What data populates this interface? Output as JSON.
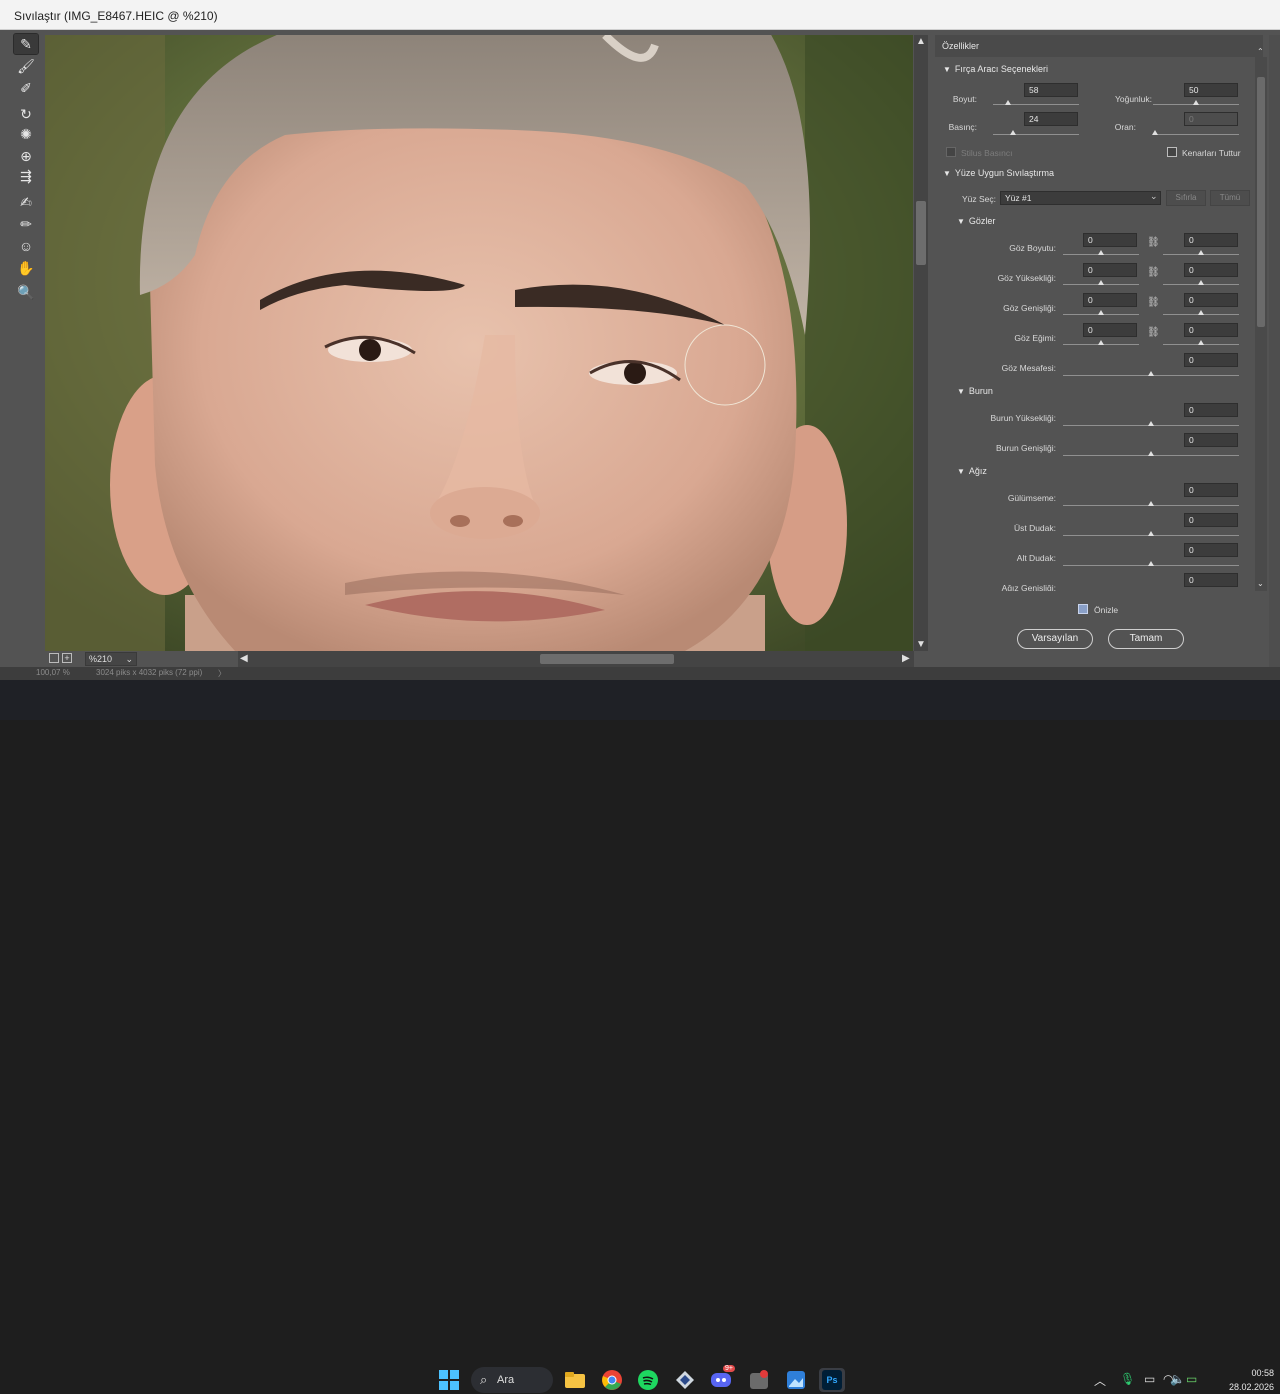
{
  "window": {
    "title": "Sıvılaştır (IMG_E8467.HEIC @ %210)"
  },
  "tools": [
    {
      "name": "forward-warp-icon",
      "glyph": "✎"
    },
    {
      "name": "reconstruct-icon",
      "glyph": "🖌"
    },
    {
      "name": "smooth-icon",
      "glyph": "✐"
    },
    {
      "name": "twirl-icon",
      "glyph": "↻"
    },
    {
      "name": "pucker-icon",
      "glyph": "✺"
    },
    {
      "name": "bloat-icon",
      "glyph": "⊕"
    },
    {
      "name": "push-left-icon",
      "glyph": "⇶"
    },
    {
      "name": "freeze-mask-icon",
      "glyph": "✍"
    },
    {
      "name": "thaw-mask-icon",
      "glyph": "✏"
    },
    {
      "name": "face-tool-icon",
      "glyph": "☺"
    },
    {
      "name": "hand-icon",
      "glyph": "✋"
    },
    {
      "name": "zoom-icon",
      "glyph": "🔍"
    }
  ],
  "canvas": {
    "zoom": "%210"
  },
  "statusbar": {
    "left": "100,07 %",
    "info": "3024 piks x 4032 piks (72 ppi)",
    "sep": "〉"
  },
  "panel": {
    "title": "Özellikler",
    "brush": {
      "title": "Fırça Aracı Seçenekleri",
      "size_label": "Boyut:",
      "size": "58",
      "density_label": "Yoğunluk:",
      "density": "50",
      "pressure_label": "Basınç:",
      "pressure": "24",
      "rate_label": "Oran:",
      "rate": "0",
      "stylus_label": "Stilus Basıncı",
      "pin_label": "Kenarları Tuttur"
    },
    "face": {
      "title": "Yüze Uygun Sıvılaştırma",
      "select_label": "Yüz Seç:",
      "select_value": "Yüz #1",
      "reset_label": "Sıfırla",
      "all_label": "Tümü",
      "eyes_title": "Gözler",
      "eyes": [
        {
          "label": "Göz Boyutu:",
          "left": "0",
          "right": "0"
        },
        {
          "label": "Göz Yüksekliği:",
          "left": "0",
          "right": "0"
        },
        {
          "label": "Göz Genişliği:",
          "left": "0",
          "right": "0"
        },
        {
          "label": "Göz Eğimi:",
          "left": "0",
          "right": "0"
        }
      ],
      "eye_distance_label": "Göz Mesafesi:",
      "eye_distance": "0",
      "nose_title": "Burun",
      "nose": [
        {
          "label": "Burun Yüksekliği:",
          "value": "0"
        },
        {
          "label": "Burun Genişliği:",
          "value": "0"
        }
      ],
      "mouth_title": "Ağız",
      "mouth": [
        {
          "label": "Gülümseme:",
          "value": "0"
        },
        {
          "label": "Üst Dudak:",
          "value": "0"
        },
        {
          "label": "Alt Dudak:",
          "value": "0"
        },
        {
          "label": "Ağız Genişliği:",
          "value": "0"
        }
      ]
    },
    "preview_label": "Önizle",
    "defaults_label": "Varsayılan",
    "ok_label": "Tamam"
  },
  "taskbar": {
    "search_label": "Ara",
    "time": "00:58",
    "date": "28.02.2026",
    "discord_badge": "9+",
    "ps_label": "Ps"
  }
}
